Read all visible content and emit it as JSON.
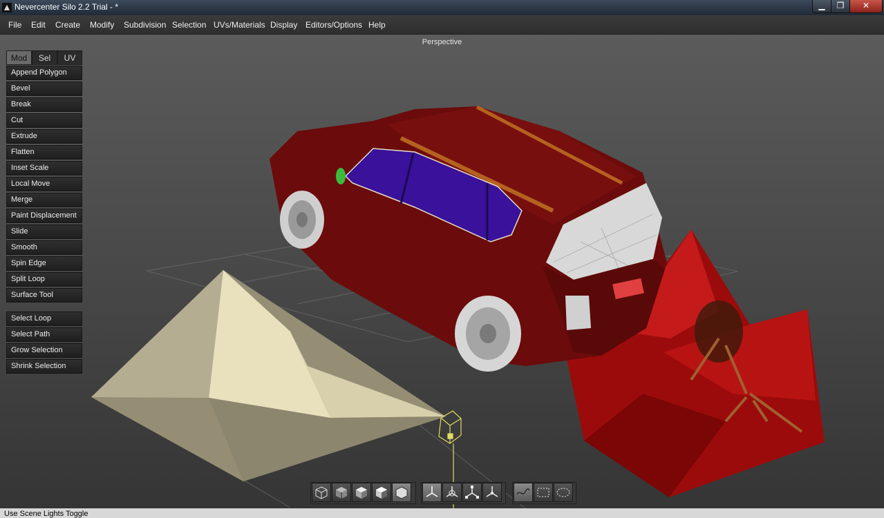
{
  "window": {
    "title": "Nevercenter Silo 2.2 Trial - *",
    "minimize": "▁",
    "maximize": "❐",
    "close": "✕"
  },
  "menu": [
    "File",
    "Edit",
    "Create",
    "Modify",
    "Subdivision",
    "Selection",
    "UVs/Materials",
    "Display",
    "Editors/Options",
    "Help"
  ],
  "viewport": {
    "label": "Perspective"
  },
  "tabs": [
    {
      "label": "Mod",
      "active": true
    },
    {
      "label": "Sel",
      "active": false
    },
    {
      "label": "UV",
      "active": false
    }
  ],
  "tools": [
    "Append Polygon",
    "Bevel",
    "Break",
    "Cut",
    "Extrude",
    "Flatten",
    "Inset Scale",
    "Local Move",
    "Merge",
    "Paint Displacement",
    "Slide",
    "Smooth",
    "Spin Edge",
    "Split Loop",
    "Surface Tool"
  ],
  "selection_tools": [
    "Select Loop",
    "Select Path",
    "Grow Selection",
    "Shrink Selection"
  ],
  "bottom_toolbar": {
    "display_modes": [
      "wireframe-cube-icon",
      "flat-cube-icon",
      "shaded-cube-icon",
      "smooth-cube-icon",
      "hexagon-cube-icon"
    ],
    "manipulators": [
      "move-manipulator-icon",
      "rotate-manipulator-icon",
      "scale-manipulator-icon",
      "universal-manipulator-icon"
    ],
    "selection_modes": [
      "paint-select-icon",
      "rectangle-select-icon",
      "lasso-select-icon"
    ]
  },
  "status": "Use Scene Lights Toggle",
  "colors": {
    "car_body": "#6b0b0b",
    "glass": "#3a119a",
    "pyramid": "#d8cfae",
    "gizmo": "#e3dc63"
  }
}
